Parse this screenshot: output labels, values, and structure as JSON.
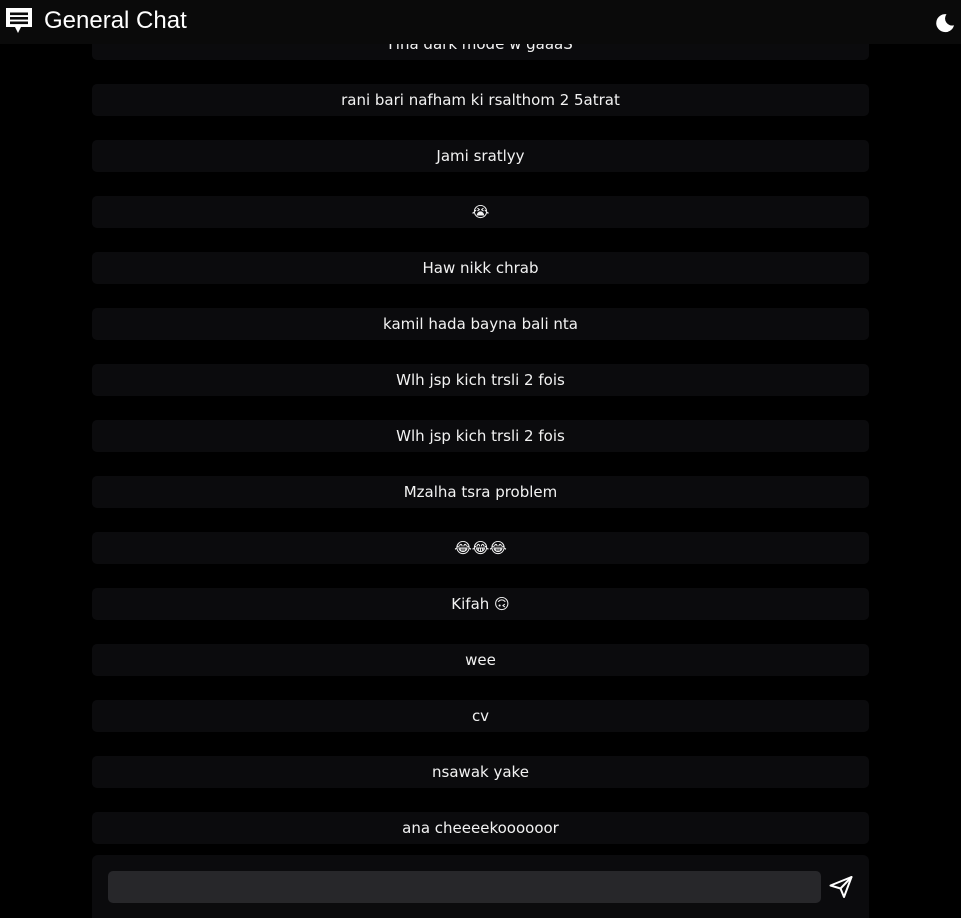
{
  "header": {
    "title": "General Chat",
    "logo_icon": "chat-bubble-icon",
    "theme_toggle_icon": "moon-icon"
  },
  "messages": [
    {
      "text": "Fina dark mode w gaaaS"
    },
    {
      "text": "rani bari nafham ki rsalthom 2 5atrat"
    },
    {
      "text": "Jami sratlyy"
    },
    {
      "text": "😭"
    },
    {
      "text": "Haw nikk chrab"
    },
    {
      "text": "kamil hada bayna bali nta"
    },
    {
      "text": "Wlh jsp kich trsli 2 fois"
    },
    {
      "text": "Wlh jsp kich trsli 2 fois"
    },
    {
      "text": "Mzalha tsra problem"
    },
    {
      "text": "😂😂😂"
    },
    {
      "text": "Kifah 🙃"
    },
    {
      "text": "wee"
    },
    {
      "text": "cv"
    },
    {
      "text": "nsawak yake"
    },
    {
      "text": "ana cheeeekoooooor"
    }
  ],
  "composer": {
    "value": "",
    "placeholder": "",
    "send_icon": "send-icon"
  },
  "colors": {
    "background": "#000000",
    "header_bg": "#0a0a0a",
    "message_bg": "#0b0b0d",
    "input_bg": "#27272a",
    "text": "#ffffff"
  }
}
